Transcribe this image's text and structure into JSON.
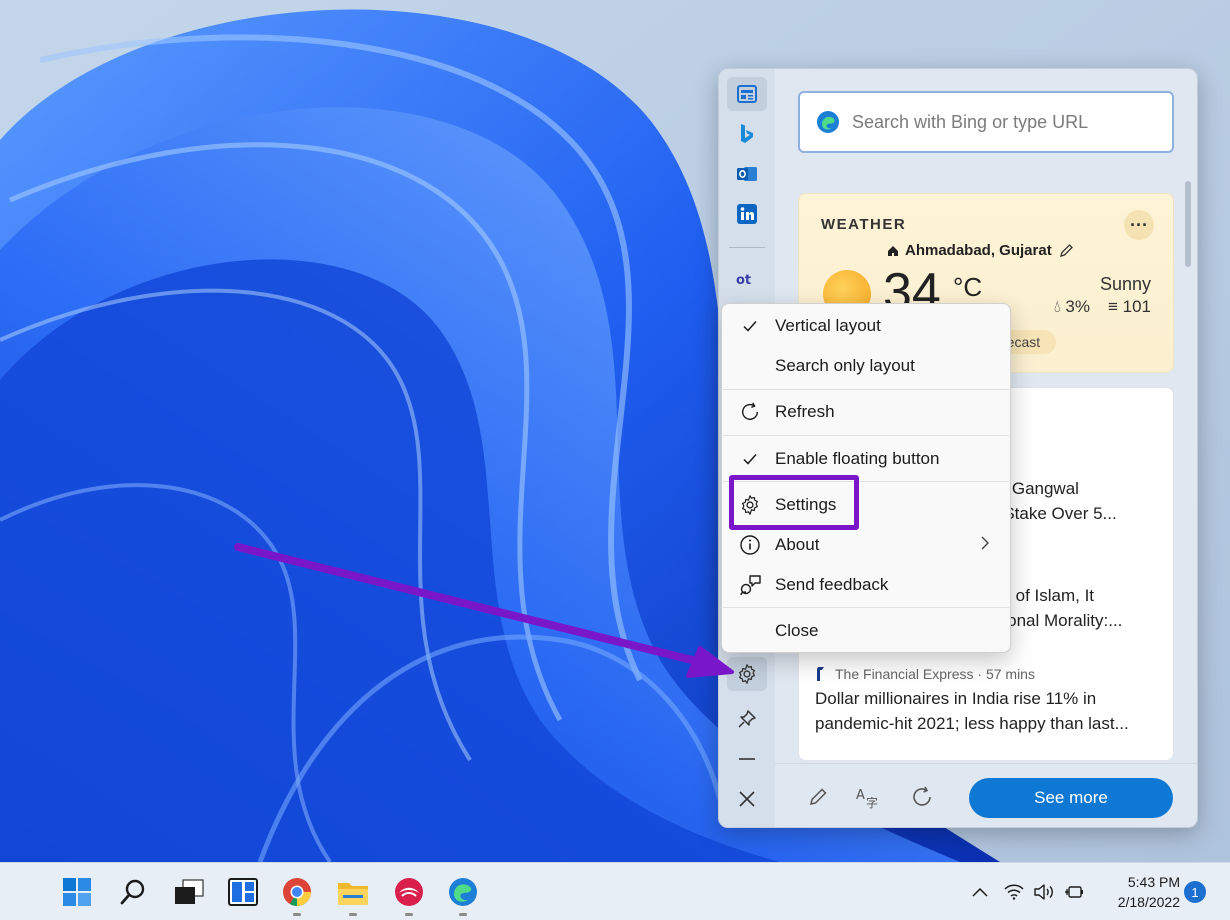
{
  "sidebar": {
    "search_placeholder": "Search with Bing or type URL",
    "rail_apps": [
      "news-feed",
      "bing",
      "outlook",
      "linkedin",
      "office"
    ],
    "weather": {
      "title": "WEATHER",
      "location": "Ahmadabad, Gujarat",
      "temperature": "34",
      "unit": "°C",
      "condition": "Sunny",
      "precipitation": "3%",
      "aqi": "101",
      "forecast_button": "...ecast"
    },
    "news": [
      {
        "title_line1": "...sh Gangwal",
        "title_line2": "...e Stake Over 5..."
      },
      {
        "title_line1": "...ice of Islam, It",
        "title_line2": "...utional Morality:..."
      },
      {
        "source": "The Financial Express · 57 mins",
        "title_line1": "Dollar millionaires in India rise 11% in",
        "title_line2": "pandemic-hit 2021; less happy than last..."
      }
    ],
    "see_more_label": "See more"
  },
  "context_menu": {
    "items": [
      {
        "label": "Vertical layout",
        "checked": true
      },
      {
        "label": "Search only layout",
        "checked": false
      },
      {
        "label": "Refresh",
        "icon": "refresh-icon"
      },
      {
        "label": "Enable floating button",
        "checked": true
      },
      {
        "label": "Settings",
        "icon": "gear-icon",
        "highlighted": true
      },
      {
        "label": "About",
        "icon": "info-icon",
        "submenu": true
      },
      {
        "label": "Send feedback",
        "icon": "feedback-icon"
      },
      {
        "label": "Close"
      }
    ]
  },
  "taskbar": {
    "apps": [
      "start",
      "search",
      "task-view",
      "widgets",
      "chrome",
      "file-explorer",
      "app",
      "edge"
    ],
    "time": "5:43 PM",
    "date": "2/18/2022",
    "notification_count": "1"
  },
  "colors": {
    "accent": "#0f78d4",
    "highlight": "#7a16c9",
    "wallpaper_blue": "#1d5ce8"
  }
}
